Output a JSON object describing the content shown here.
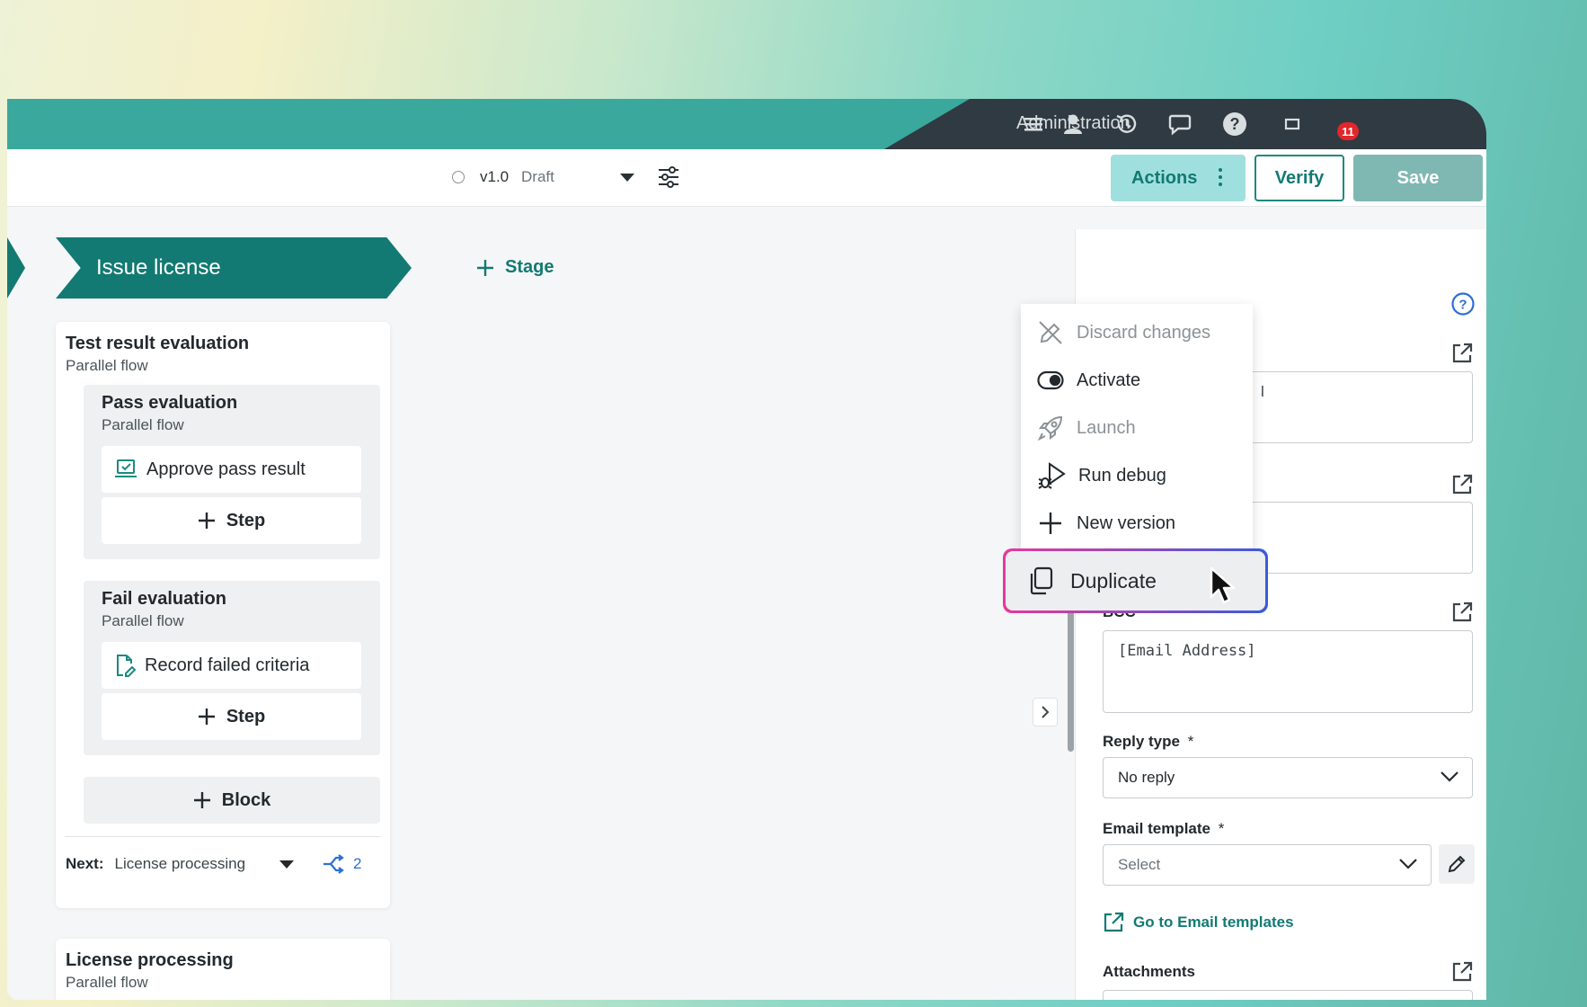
{
  "nav": {
    "admin_label": "Administration",
    "notification_count": "11"
  },
  "toolbar": {
    "version": "v1.0",
    "status": "Draft",
    "actions_label": "Actions",
    "verify_label": "Verify",
    "save_label": "Save"
  },
  "stage": {
    "name": "Issue license",
    "add_stage_label": "Stage"
  },
  "cards": {
    "test_result": {
      "title": "Test result evaluation",
      "subtitle": "Parallel flow",
      "blocks": [
        {
          "title": "Pass evaluation",
          "subtitle": "Parallel flow",
          "step": "Approve pass result",
          "add_step": "Step"
        },
        {
          "title": "Fail evaluation",
          "subtitle": "Parallel flow",
          "step": "Record failed criteria",
          "add_step": "Step"
        }
      ],
      "add_block": "Block",
      "next_label": "Next:",
      "next_value": "License processing",
      "branch_count": "2"
    },
    "license_processing": {
      "title": "License processing",
      "subtitle": "Parallel flow"
    }
  },
  "menu": {
    "items": [
      {
        "label": "Discard changes",
        "icon": "pencil-off-icon",
        "enabled": false
      },
      {
        "label": "Activate",
        "icon": "toggle-icon",
        "enabled": true
      },
      {
        "label": "Launch",
        "icon": "rocket-icon",
        "enabled": false
      },
      {
        "label": "Run debug",
        "icon": "bug-play-icon",
        "enabled": true
      },
      {
        "label": "New version",
        "icon": "plus-icon",
        "enabled": true
      }
    ],
    "highlighted": {
      "label": "Duplicate",
      "icon": "copy-icon"
    }
  },
  "panel": {
    "partial_text": "l",
    "obscured_text": "[Email Address]",
    "bcc_label": "BCC",
    "bcc_value": "[Email Address]",
    "reply_type_label": "Reply type",
    "reply_type_value": "No reply",
    "email_template_label": "Email template",
    "email_template_placeholder": "Select",
    "templates_link": "Go to Email templates",
    "attachments_label": "Attachments",
    "required_mark": "*"
  },
  "colors": {
    "brand_teal": "#127a73",
    "topbar_teal": "#3aa89c",
    "topbar_dark": "#2f3a42",
    "badge_red": "#e1262c"
  }
}
